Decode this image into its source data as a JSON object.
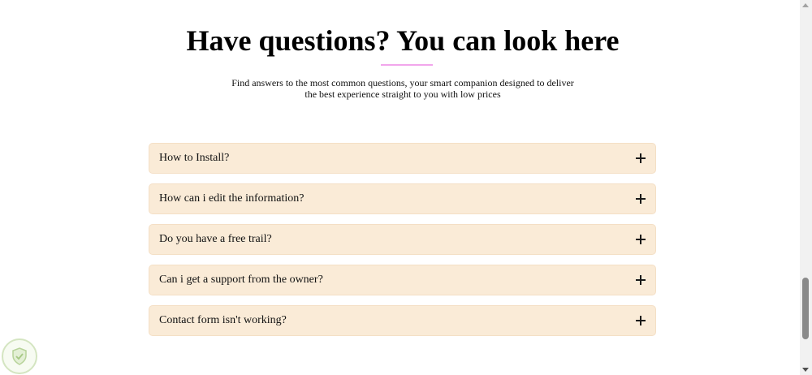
{
  "faq": {
    "title": "Have questions? You can look here",
    "subtitle": "Find answers to the most common questions, your smart companion designed to deliver the best experience straight to you with low prices",
    "items": [
      {
        "question": "How to Install?"
      },
      {
        "question": "How can i edit the information?"
      },
      {
        "question": "Do you have a free trail?"
      },
      {
        "question": "Can i get a support from the owner?"
      },
      {
        "question": "Contact form isn't working?"
      }
    ]
  },
  "icons": {
    "expand": "plus-icon",
    "badge": "shield-check-icon"
  },
  "colors": {
    "item_background": "#faebd7",
    "accent_underline": "#f2a6ec"
  }
}
